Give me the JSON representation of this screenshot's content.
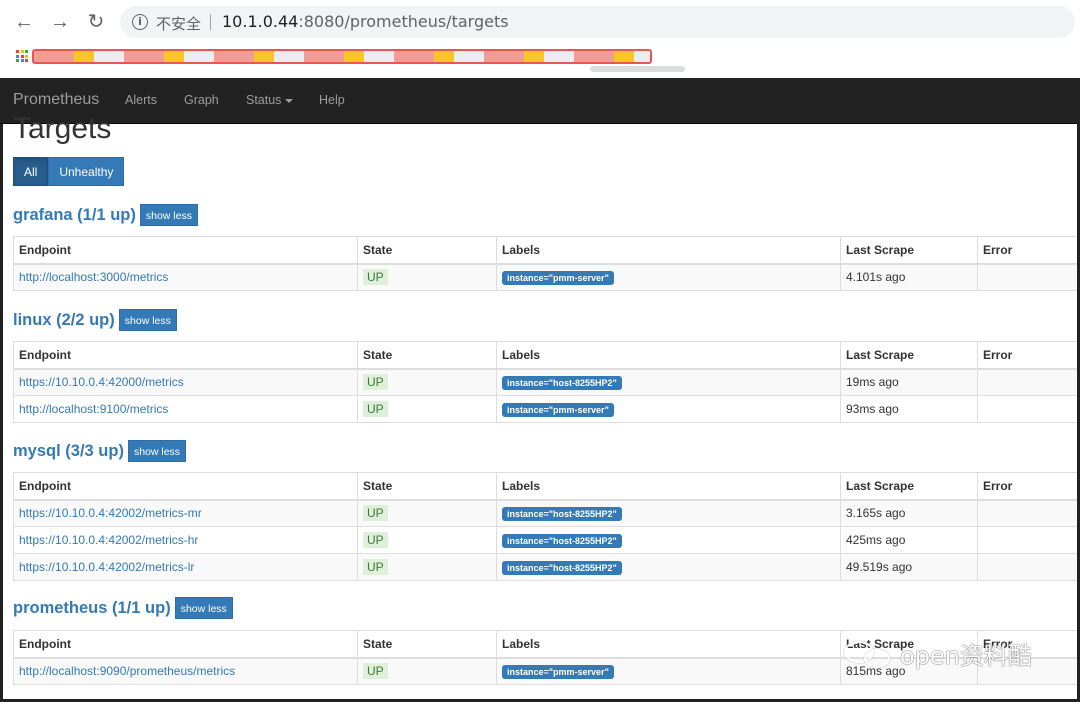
{
  "browser": {
    "back_glyph": "←",
    "forward_glyph": "→",
    "reload_glyph": "↻",
    "insecure_label": "不安全",
    "url_host": "10.1.0.44",
    "url_rest": ":8080/prometheus/targets"
  },
  "navbar": {
    "brand": "Prometheus",
    "links": [
      "Alerts",
      "Graph",
      "Status",
      "Help"
    ]
  },
  "page": {
    "title": "Targets",
    "filters": [
      "All",
      "Unhealthy"
    ],
    "show_less_label": "show less"
  },
  "columns": [
    "Endpoint",
    "State",
    "Labels",
    "Last Scrape",
    "Error"
  ],
  "jobs": [
    {
      "title": "grafana (1/1 up)",
      "rows": [
        {
          "endpoint": "http://localhost:3000/metrics",
          "state": "UP",
          "label": "instance=\"pmm-server\"",
          "last_scrape": "4.101s ago",
          "error": ""
        }
      ]
    },
    {
      "title": "linux (2/2 up)",
      "rows": [
        {
          "endpoint": "https://10.10.0.4:42000/metrics",
          "state": "UP",
          "label": "instance=\"host-8255HP2\"",
          "last_scrape": "19ms ago",
          "error": ""
        },
        {
          "endpoint": "http://localhost:9100/metrics",
          "state": "UP",
          "label": "instance=\"pmm-server\"",
          "last_scrape": "93ms ago",
          "error": ""
        }
      ]
    },
    {
      "title": "mysql (3/3 up)",
      "rows": [
        {
          "endpoint": "https://10.10.0.4:42002/metrics-mr",
          "state": "UP",
          "label": "instance=\"host-8255HP2\"",
          "last_scrape": "3.165s ago",
          "error": ""
        },
        {
          "endpoint": "https://10.10.0.4:42002/metrics-hr",
          "state": "UP",
          "label": "instance=\"host-8255HP2\"",
          "last_scrape": "425ms ago",
          "error": ""
        },
        {
          "endpoint": "https://10.10.0.4:42002/metrics-lr",
          "state": "UP",
          "label": "instance=\"host-8255HP2\"",
          "last_scrape": "49.519s ago",
          "error": ""
        }
      ]
    },
    {
      "title": "prometheus (1/1 up)",
      "rows": [
        {
          "endpoint": "http://localhost:9090/prometheus/metrics",
          "state": "UP",
          "label": "instance=\"pmm-server\"",
          "last_scrape": "815ms ago",
          "error": ""
        }
      ]
    }
  ],
  "watermark": {
    "text": "open资料酷"
  },
  "colors": {
    "navbar": "#222222",
    "link": "#337ab7",
    "up_bg": "#dff0d8",
    "up_text": "#3c763d"
  }
}
